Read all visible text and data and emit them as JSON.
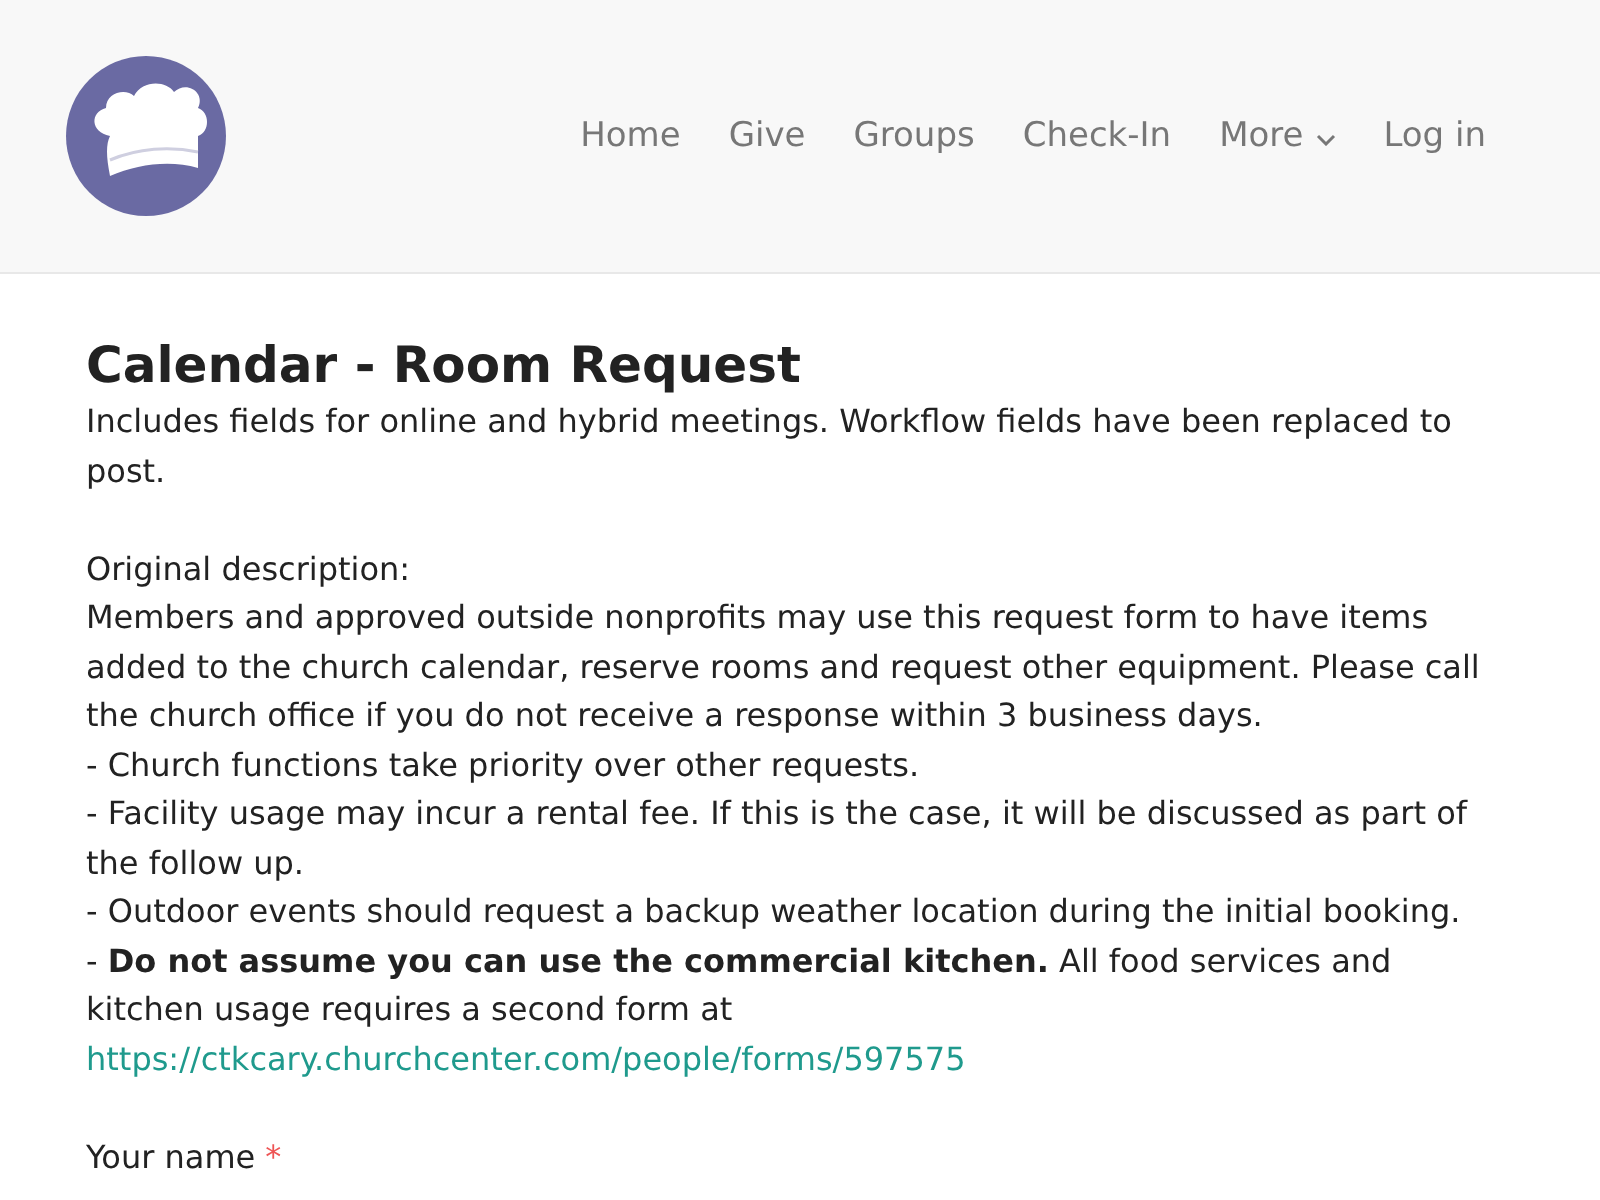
{
  "header": {
    "nav": [
      {
        "label": "Home",
        "kind": "link"
      },
      {
        "label": "Give",
        "kind": "link"
      },
      {
        "label": "Groups",
        "kind": "link"
      },
      {
        "label": "Check-In",
        "kind": "link"
      },
      {
        "label": "More",
        "kind": "dropdown"
      },
      {
        "label": "Log in",
        "kind": "link"
      }
    ]
  },
  "form": {
    "title": "Calendar - Room Request",
    "intro": "Includes fields for online and hybrid meetings. Workflow fields have been replaced to post.",
    "description": [
      "Original description:",
      "Members and approved outside nonprofits may use this request form to have items added to the church calendar, reserve rooms and request other equipment. Please call the church office if you do not receive a response within 3 business days.",
      "- Church functions take priority over other requests.",
      "- Facility usage may incur a rental fee. If this is the case, it will be discussed as part of the follow up.",
      "- Outdoor events should request a backup weather location during the initial booking.",
      "- **Do not assume you can use the commercial kitchen.** All food services and kitchen usage requires a second form at"
    ],
    "link": "https://ctkcary.churchcenter.com/people/forms/597575",
    "fields": [
      {
        "label": "Your name",
        "required": true,
        "required_mark": "*"
      }
    ]
  }
}
